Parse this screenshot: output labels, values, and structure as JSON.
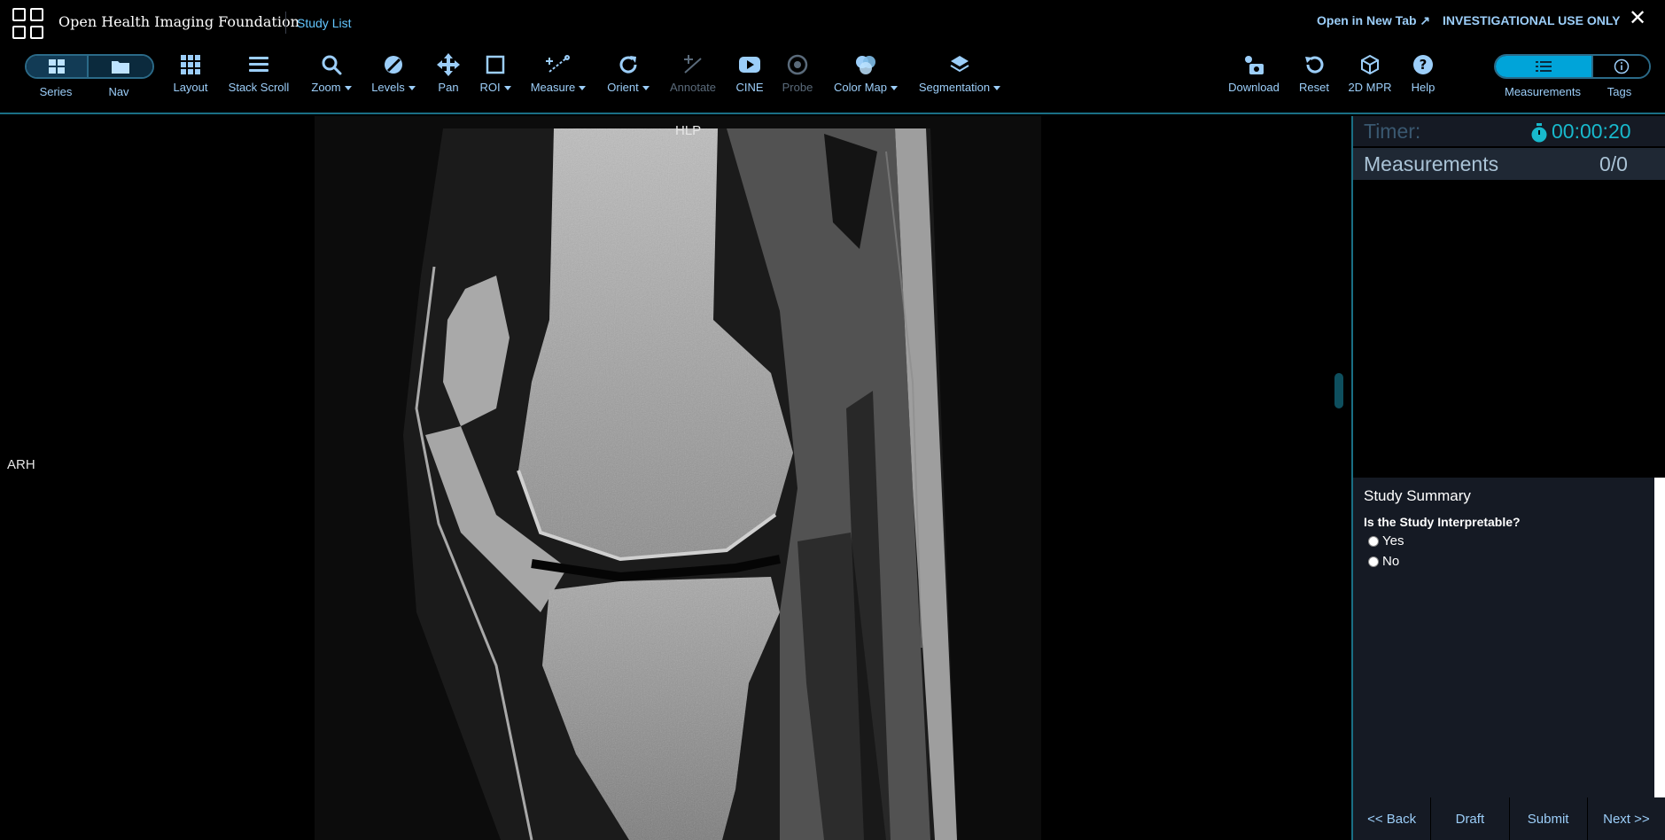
{
  "header": {
    "brand": "Open Health Imaging Foundation",
    "study_list": "Study List",
    "open_new_tab": "Open in New Tab ↗",
    "investigational": "INVESTIGATIONAL USE ONLY",
    "close_glyph": "✕"
  },
  "toolbar": {
    "series_label": "Series",
    "nav_label": "Nav",
    "layout": "Layout",
    "stack_scroll": "Stack Scroll",
    "zoom": "Zoom",
    "levels": "Levels",
    "pan": "Pan",
    "roi": "ROI",
    "measure": "Measure",
    "orient": "Orient",
    "annotate": "Annotate",
    "cine": "CINE",
    "probe": "Probe",
    "color_map": "Color Map",
    "segmentation": "Segmentation",
    "download": "Download",
    "reset": "Reset",
    "mpr": "2D MPR",
    "help": "Help",
    "measurements_tab": "Measurements",
    "tags_tab": "Tags"
  },
  "viewport": {
    "top_orientation": "HLP",
    "left_orientation": "ARH"
  },
  "panel": {
    "timer_label": "Timer:",
    "timer_value": "00:00:20",
    "measurements_label": "Measurements",
    "measurements_count": "0/0",
    "summary_title": "Study Summary",
    "summary_question": "Is the Study Interpretable?",
    "options": [
      "Yes",
      "No"
    ],
    "buttons": [
      "<< Back",
      "Draft",
      "Submit",
      "Next >>"
    ]
  },
  "colors": {
    "accent": "#00a4d9",
    "label": "#9ccef9",
    "link": "#63c6ff",
    "timer": "#18b9cc",
    "panel_bg": "#151a24"
  }
}
